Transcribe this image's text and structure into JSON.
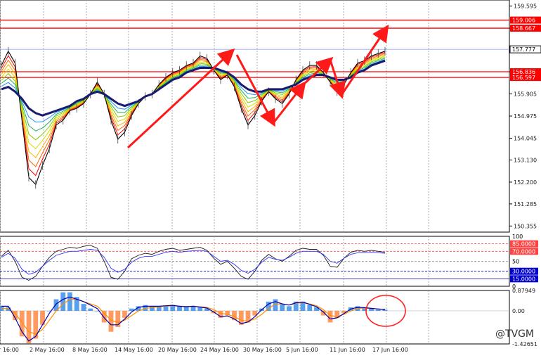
{
  "colors": {
    "grid": "#9a9a9a",
    "price_line": "#000000",
    "ribbon": [
      "#ff0000",
      "#ff6a00",
      "#ffb300",
      "#d7df00",
      "#84d100",
      "#20b15a",
      "#1e90ff"
    ],
    "ma_thick": "#1a1a6e",
    "resistance": "#ff0000",
    "current_line": "#8ea6ff",
    "arrow": "#ff1a1a",
    "rsi_fast": "#1a1a1a",
    "rsi_slow": "#ff3333",
    "rsi_signal": "#3333ff",
    "level_high": "#ff4444",
    "level_low": "#0000cc",
    "macd_pos": "#3b8eea",
    "macd_neg": "#ff8844",
    "macd_signal": "#ff8c00",
    "macd_line": "#0000aa",
    "circle": "#ff2222"
  },
  "watermark": "@TVGM",
  "chart_data": [
    {
      "type": "line",
      "title": "",
      "x_ticks": [
        "r 16:00",
        "2 May 16:00",
        "8 May 16:00",
        "14 May 16:00",
        "20 May 16:00",
        "24 May 16:00",
        "30 May 16:00",
        "5 Jun 16:00",
        "11 Jun 16:00",
        "17 Jun 16:00"
      ],
      "y_ticks": [
        "159.595",
        "158.665",
        "157.735",
        "156.835",
        "155.905",
        "154.975",
        "154.045",
        "153.130",
        "152.200",
        "151.285",
        "150.355"
      ],
      "ylim": [
        150.1,
        159.85
      ],
      "grid": true,
      "series": [
        {
          "values": [
            157.1,
            157.7,
            157.2,
            154.8,
            152.4,
            152.1,
            152.9,
            153.6,
            154.6,
            154.8,
            155.2,
            155.3,
            155.5,
            155.9,
            156.4,
            155.9,
            154.8,
            154.0,
            154.3,
            155.0,
            155.5,
            155.8,
            155.9,
            156.3,
            156.6,
            156.8,
            156.9,
            157.1,
            157.2,
            157.5,
            157.4,
            156.9,
            156.5,
            156.7,
            156.2,
            155.3,
            154.6,
            155.0,
            155.6,
            156.0,
            155.7,
            155.5,
            155.9,
            156.5,
            156.9,
            157.1,
            157.1,
            156.8,
            156.4,
            156.0,
            156.3,
            156.8,
            157.2,
            157.3,
            157.5,
            157.6,
            157.7
          ]
        }
      ],
      "reference_lines": [
        {
          "label": "159.006",
          "value": 159.006
        },
        {
          "label": "158.667",
          "value": 158.667
        },
        {
          "label": "157.777",
          "value": 157.777
        },
        {
          "label": "156.836",
          "value": 156.836
        },
        {
          "label": "156.597",
          "value": 156.597
        }
      ],
      "moving_average": [
        156.1,
        156.2,
        156.0,
        155.7,
        155.3,
        155.1,
        155.0,
        155.1,
        155.2,
        155.3,
        155.4,
        155.6,
        155.7,
        155.9,
        156.0,
        155.9,
        155.7,
        155.5,
        155.4,
        155.5,
        155.6,
        155.8,
        155.9,
        156.1,
        156.3,
        156.5,
        156.6,
        156.8,
        156.9,
        157.0,
        157.0,
        157.0,
        156.9,
        156.8,
        156.6,
        156.3,
        156.1,
        156.0,
        156.0,
        156.1,
        156.1,
        156.1,
        156.2,
        156.3,
        156.5,
        156.6,
        156.7,
        156.7,
        156.6,
        156.5,
        156.5,
        156.6,
        156.8,
        156.9,
        157.1,
        157.2,
        157.3
      ]
    },
    {
      "type": "line",
      "title": "",
      "y_ticks": [
        "100",
        "85.0000",
        "70.0000",
        "50",
        "30.0000",
        "15.0000",
        "0"
      ],
      "ylim": [
        0,
        100
      ],
      "levels": [
        85,
        70,
        50,
        30,
        15
      ],
      "series": [
        {
          "values": [
            60,
            72,
            50,
            18,
            12,
            20,
            40,
            58,
            70,
            74,
            78,
            76,
            80,
            82,
            76,
            50,
            18,
            14,
            30,
            55,
            62,
            66,
            64,
            70,
            74,
            76,
            72,
            74,
            76,
            78,
            72,
            56,
            44,
            50,
            36,
            20,
            14,
            30,
            52,
            64,
            55,
            50,
            60,
            72,
            76,
            74,
            74,
            62,
            40,
            38,
            56,
            68,
            72,
            70,
            72,
            70,
            68
          ]
        },
        {
          "values": [
            58,
            66,
            56,
            34,
            24,
            28,
            40,
            52,
            62,
            66,
            70,
            70,
            72,
            74,
            72,
            58,
            36,
            28,
            34,
            48,
            56,
            60,
            60,
            64,
            68,
            70,
            68,
            70,
            71,
            72,
            70,
            60,
            50,
            52,
            44,
            32,
            26,
            34,
            48,
            58,
            54,
            52,
            58,
            66,
            70,
            70,
            70,
            64,
            50,
            46,
            56,
            64,
            67,
            67,
            68,
            67,
            66
          ]
        }
      ]
    },
    {
      "type": "bar",
      "title": "",
      "y_ticks": [
        "0.87949",
        "0.00",
        "-1.42651"
      ],
      "ylim": [
        -1.42651,
        0.87949
      ],
      "values": [
        0.2,
        0.15,
        -0.4,
        -1.1,
        -1.4,
        -1.2,
        -0.6,
        0.0,
        0.5,
        0.8,
        0.8,
        0.6,
        0.3,
        0.1,
        0.0,
        -0.5,
        -0.9,
        -0.7,
        -0.3,
        0.1,
        0.2,
        0.25,
        0.2,
        0.2,
        0.22,
        0.25,
        0.2,
        0.18,
        0.2,
        0.15,
        0.1,
        -0.1,
        -0.3,
        -0.2,
        -0.4,
        -0.6,
        -0.5,
        -0.2,
        0.1,
        0.4,
        0.5,
        0.3,
        0.2,
        0.4,
        0.4,
        0.25,
        0.15,
        -0.2,
        -0.5,
        -0.3,
        -0.1,
        0.15,
        0.2,
        0.15,
        0.1,
        0.05,
        0.05
      ],
      "signal": [
        0.1,
        0.1,
        -0.1,
        -0.5,
        -0.9,
        -1.0,
        -0.8,
        -0.4,
        0.0,
        0.3,
        0.5,
        0.5,
        0.4,
        0.3,
        0.2,
        -0.1,
        -0.4,
        -0.5,
        -0.4,
        -0.2,
        0.0,
        0.1,
        0.15,
        0.18,
        0.2,
        0.22,
        0.2,
        0.19,
        0.2,
        0.18,
        0.15,
        0.05,
        -0.1,
        -0.15,
        -0.25,
        -0.4,
        -0.45,
        -0.35,
        -0.15,
        0.1,
        0.3,
        0.3,
        0.25,
        0.32,
        0.36,
        0.3,
        0.22,
        0.05,
        -0.2,
        -0.25,
        -0.15,
        0.0,
        0.1,
        0.12,
        0.1,
        0.08,
        0.07
      ],
      "macd_line": [
        0.2,
        0.2,
        -0.3,
        -0.9,
        -1.3,
        -1.1,
        -0.6,
        -0.1,
        0.3,
        0.5,
        0.6,
        0.5,
        0.4,
        0.25,
        0.1,
        -0.3,
        -0.6,
        -0.6,
        -0.35,
        -0.05,
        0.15,
        0.2,
        0.2,
        0.2,
        0.22,
        0.24,
        0.2,
        0.18,
        0.2,
        0.16,
        0.12,
        -0.05,
        -0.25,
        -0.22,
        -0.35,
        -0.55,
        -0.48,
        -0.25,
        0.05,
        0.3,
        0.4,
        0.3,
        0.25,
        0.35,
        0.38,
        0.28,
        0.18,
        -0.05,
        -0.35,
        -0.3,
        -0.12,
        0.08,
        0.15,
        0.14,
        0.11,
        0.08,
        0.06
      ]
    }
  ]
}
